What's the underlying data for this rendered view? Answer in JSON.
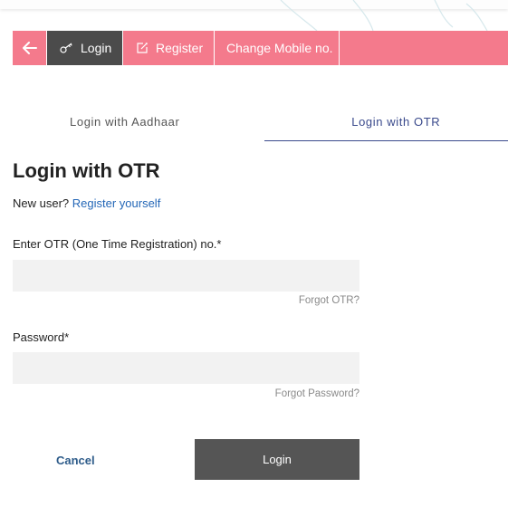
{
  "nav": {
    "back_icon": "arrow-left-icon",
    "login_label": "Login",
    "login_icon": "key-icon",
    "register_label": "Register",
    "register_icon": "edit-icon",
    "change_mobile_label": "Change Mobile no.",
    "color": "#f47a8c",
    "active_color": "#4b4b4b"
  },
  "tabs": [
    {
      "label": "Login with Aadhaar",
      "active": false
    },
    {
      "label": "Login with OTR",
      "active": true
    }
  ],
  "form": {
    "title": "Login with OTR",
    "new_user_text": "New user?",
    "register_link": "Register yourself",
    "otr_label": "Enter OTR (One Time Registration) no.*",
    "otr_value": "",
    "forgot_otr": "Forgot OTR?",
    "password_label": "Password*",
    "password_value": "",
    "forgot_password": "Forgot Password?",
    "cancel_label": "Cancel",
    "login_button_label": "Login"
  }
}
